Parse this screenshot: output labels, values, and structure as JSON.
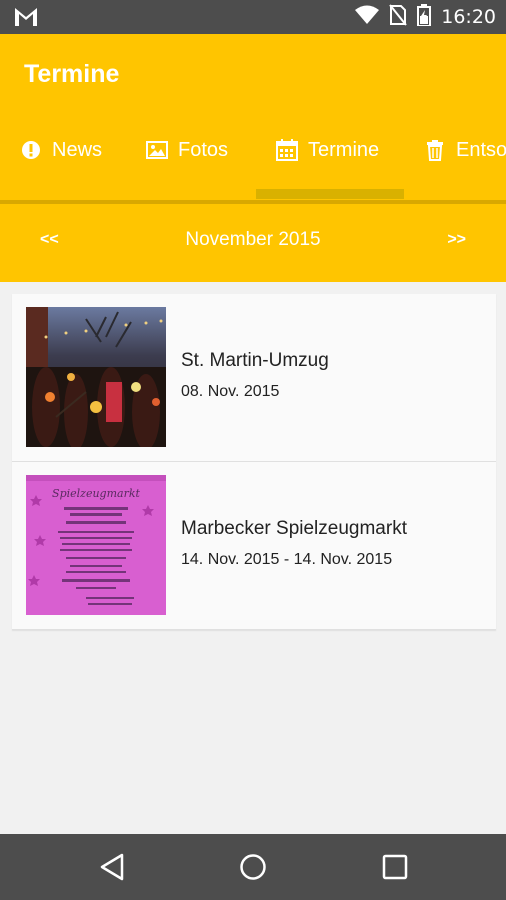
{
  "status_bar": {
    "time": "16:20",
    "icons": [
      "gmail-icon",
      "wifi-icon",
      "no-sim-icon",
      "battery-icon"
    ]
  },
  "app_bar": {
    "title": "Termine",
    "tabs": [
      {
        "label": "News",
        "icon": "alert-circle-icon"
      },
      {
        "label": "Fotos",
        "icon": "image-icon"
      },
      {
        "label": "Termine",
        "icon": "calendar-icon",
        "selected": true
      },
      {
        "label": "Entso",
        "icon": "trash-icon"
      }
    ]
  },
  "month_nav": {
    "prev_label": "<<",
    "month": "November 2015",
    "next_label": ">>"
  },
  "events": [
    {
      "title": "St. Martin-Umzug",
      "date": "08. Nov. 2015",
      "thumb": "lantern-parade-photo"
    },
    {
      "title": "Marbecker Spielzeugmarkt",
      "date": "14. Nov. 2015 - 14. Nov. 2015",
      "thumb": "pink-flyer-photo"
    }
  ],
  "colors": {
    "accent": "#ffc500",
    "status_bar": "#4d4d4d",
    "background": "#f1f1f1"
  }
}
